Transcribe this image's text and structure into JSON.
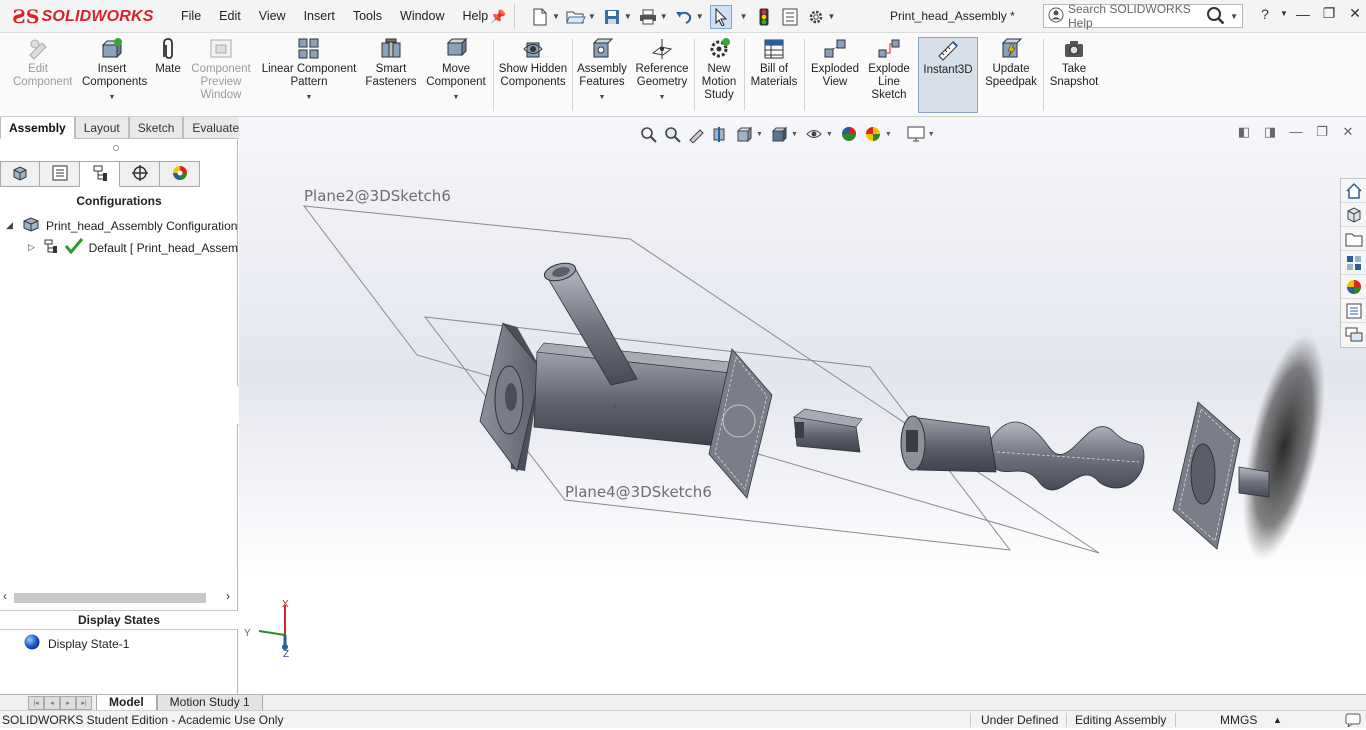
{
  "app": {
    "logo_text": "SOLIDWORKS",
    "document_title": "Print_head_Assembly *",
    "search_placeholder": "Search SOLIDWORKS Help"
  },
  "menu": [
    "File",
    "Edit",
    "View",
    "Insert",
    "Tools",
    "Window",
    "Help"
  ],
  "ribbon": {
    "edit_component": "Edit Component",
    "insert_components": "Insert Components",
    "mate": "Mate",
    "component_preview": "Component Preview Window",
    "linear_pattern": "Linear Component Pattern",
    "smart_fasteners": "Smart Fasteners",
    "move_component": "Move Component",
    "show_hidden": "Show Hidden Components",
    "assembly_features": "Assembly Features",
    "reference_geometry": "Reference Geometry",
    "motion_study": "New Motion Study",
    "bill_of_materials": "Bill of Materials",
    "exploded_view": "Exploded View",
    "explode_line": "Explode Line Sketch",
    "instant3d": "Instant3D",
    "update_speedpak": "Update Speedpak",
    "take_snapshot": "Take Snapshot"
  },
  "cm_tabs": [
    "Assembly",
    "Layout",
    "Sketch",
    "Evaluate"
  ],
  "left_panel": {
    "section_title": "Configurations",
    "root_item": "Print_head_Assembly Configuration",
    "default_item": "Default [ Print_head_Assem",
    "display_states_title": "Display States",
    "display_state": "Display State-1"
  },
  "viewport": {
    "plane_top": "Plane2@3DSketch6",
    "plane_bottom": "Plane4@3DSketch6",
    "triad": {
      "x": "X",
      "y": "Y",
      "z": "Z"
    }
  },
  "bottom_tabs": [
    "Model",
    "Motion Study 1"
  ],
  "status": {
    "edition": "SOLIDWORKS Student Edition - Academic Use Only",
    "definition": "Under Defined",
    "mode": "Editing Assembly",
    "units": "MMGS"
  },
  "colors": {
    "brand": "#d8232a",
    "accent": "#3a7bd5",
    "part": "#6e7280"
  }
}
